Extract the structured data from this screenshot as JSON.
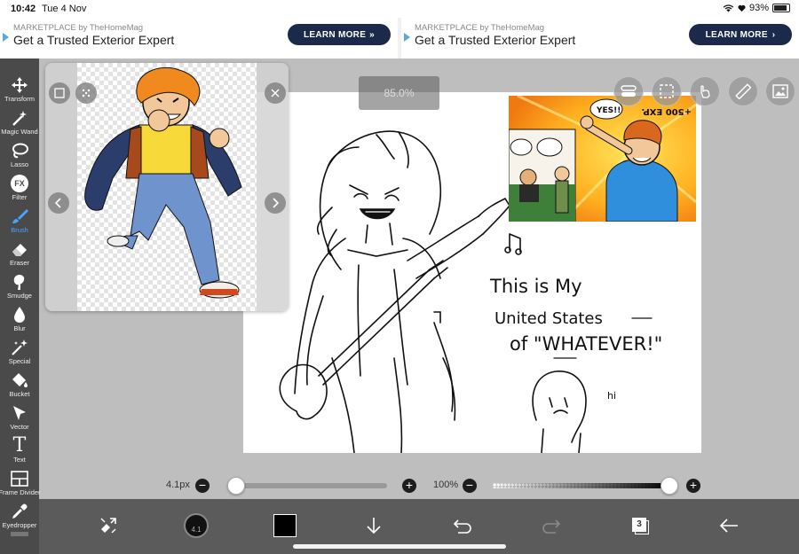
{
  "status_bar": {
    "time": "10:42",
    "date": "Tue 4 Nov",
    "battery": "93%"
  },
  "ads": [
    {
      "sponsor": "MARKETPLACE by TheHomeMag",
      "headline": "Get a Trusted Exterior Expert",
      "cta": "LEARN MORE"
    },
    {
      "sponsor": "MARKETPLACE by TheHomeMag",
      "headline": "Get a Trusted Exterior Expert",
      "cta": "LEARN MORE"
    }
  ],
  "tools": [
    {
      "label": "Transform",
      "icon": "move-arrows-icon"
    },
    {
      "label": "Magic Wand",
      "icon": "magic-wand-icon"
    },
    {
      "label": "Lasso",
      "icon": "lasso-icon"
    },
    {
      "label": "Filter",
      "icon": "fx-icon",
      "glyph": "FX"
    },
    {
      "label": "Brush",
      "icon": "brush-icon",
      "active": true
    },
    {
      "label": "Eraser",
      "icon": "eraser-icon"
    },
    {
      "label": "Smudge",
      "icon": "smudge-icon"
    },
    {
      "label": "Blur",
      "icon": "drop-icon"
    },
    {
      "label": "Special",
      "icon": "sparkle-wand-icon"
    },
    {
      "label": "Bucket",
      "icon": "bucket-icon"
    },
    {
      "label": "Vector",
      "icon": "cursor-arrow-icon"
    },
    {
      "label": "Text",
      "icon": "text-t-icon",
      "glyph": "T"
    },
    {
      "label": "Frame Divider",
      "icon": "frame-divider-icon"
    },
    {
      "label": "Eyedropper",
      "icon": "eyedropper-icon"
    }
  ],
  "zoom_indicator": "85.0%",
  "canvas_text": {
    "line1": "This is My",
    "line2": "United States",
    "line3": "of \"WHATEVER!\"",
    "small": "hi"
  },
  "comic": {
    "sfx": "+500 EXP.",
    "shout": "YES!!"
  },
  "brush_size": {
    "label": "4.1px",
    "value": 4.1,
    "fraction": 0.05
  },
  "opacity": {
    "label": "100%",
    "value": 100
  },
  "bottom": {
    "layers_count": "3",
    "brush_preview_label": "4.1"
  },
  "colors": {
    "accent": "#2d7cf6",
    "toolbar": "#4a4a4a",
    "bottombar": "#5b5b5b",
    "current_color": "#000000",
    "ad_button": "#1b2a4a"
  }
}
